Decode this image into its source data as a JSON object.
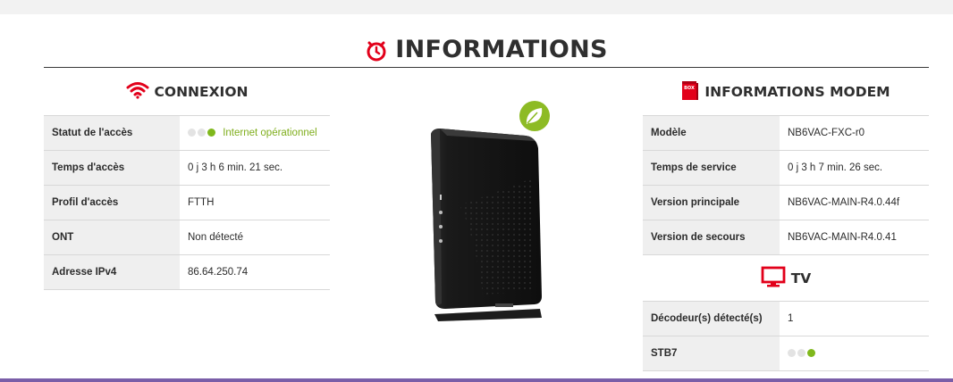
{
  "page": {
    "title": "INFORMATIONS",
    "accent_color": "#e2001a",
    "status_color": "#7fb81c",
    "bottom_bar_color": "#7a5ea8"
  },
  "connexion": {
    "title": "CONNEXION",
    "icon": "wifi-icon",
    "rows": [
      {
        "label": "Statut de l'accès",
        "value": "Internet opérationnel",
        "status_dots": 3,
        "status_active": 1
      },
      {
        "label": "Temps d'accès",
        "value": "0 j 3 h 6 min. 21 sec."
      },
      {
        "label": "Profil d'accès",
        "value": "FTTH"
      },
      {
        "label": "ONT",
        "value": "Non détecté"
      },
      {
        "label": "Adresse IPv4",
        "value": "86.64.250.74"
      }
    ]
  },
  "modem_image": {
    "icon": "router-image",
    "badge_icon": "leaf-icon"
  },
  "modem": {
    "title": "INFORMATIONS MODEM",
    "icon": "box-icon",
    "icon_text": "BOX",
    "rows": [
      {
        "label": "Modèle",
        "value": "NB6VAC-FXC-r0"
      },
      {
        "label": "Temps de service",
        "value": "0 j 3 h 7 min. 26 sec."
      },
      {
        "label": "Version principale",
        "value": "NB6VAC-MAIN-R4.0.44f"
      },
      {
        "label": "Version de secours",
        "value": "NB6VAC-MAIN-R4.0.41"
      }
    ]
  },
  "tv": {
    "title": "TV",
    "icon": "tv-icon",
    "rows": [
      {
        "label": "Décodeur(s) détecté(s)",
        "value": "1"
      },
      {
        "label": "STB7",
        "value": "",
        "status_dots": 3,
        "status_active": 1
      }
    ]
  }
}
